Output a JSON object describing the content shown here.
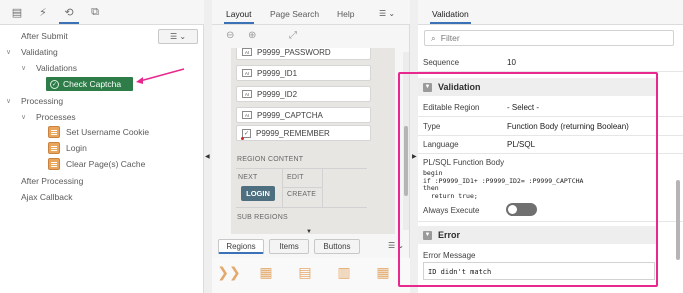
{
  "left": {
    "tree": {
      "after_submit": "After Submit",
      "validating": "Validating",
      "validations": "Validations",
      "check_captcha": "Check Captcha",
      "processing": "Processing",
      "processes": "Processes",
      "process_items": [
        "Set Username Cookie",
        "Login",
        "Clear Page(s) Cache"
      ],
      "after_processing": "After Processing",
      "ajax_callback": "Ajax Callback"
    },
    "tab_icons": [
      "rendering-icon",
      "dynamic-actions-icon",
      "processing-icon",
      "shared-components-icon"
    ]
  },
  "middle": {
    "tabs": [
      "Layout",
      "Page Search",
      "Help"
    ],
    "items": [
      "P9999_PASSWORD",
      "P9999_ID1",
      "P9999_ID2",
      "P9999_CAPTCHA",
      "P9999_REMEMBER"
    ],
    "region_content": "REGION CONTENT",
    "cells": {
      "next": "NEXT",
      "edit": "EDIT",
      "create": "CREATE"
    },
    "login_button": "LOGIN",
    "sub_regions": "SUB REGIONS",
    "bottom_tabs": [
      "Regions",
      "Items",
      "Buttons"
    ]
  },
  "right": {
    "tab": "Validation",
    "filter_placeholder": "Filter",
    "sequence_label": "Sequence",
    "sequence_value": "10",
    "section_validation": "Validation",
    "editable_region_label": "Editable Region",
    "editable_region_value": "- Select -",
    "type_label": "Type",
    "type_value": "Function Body (returning Boolean)",
    "language_label": "Language",
    "language_value": "PL/SQL",
    "plsql_label": "PL/SQL Function Body",
    "code": "begin\nif :P9999_ID1+ :P9999_ID2= :P9999_CAPTCHA\nthen\n  return true;",
    "always_execute_label": "Always Execute",
    "section_error": "Error",
    "error_message_label": "Error Message",
    "error_message_value": "ID didn't match"
  },
  "colors": {
    "accent": "#3a71b7",
    "selected_node": "#2e7d48",
    "highlight": "#e8288d",
    "login_button": "#4d6f80",
    "process_icon": "#e9a55c"
  }
}
